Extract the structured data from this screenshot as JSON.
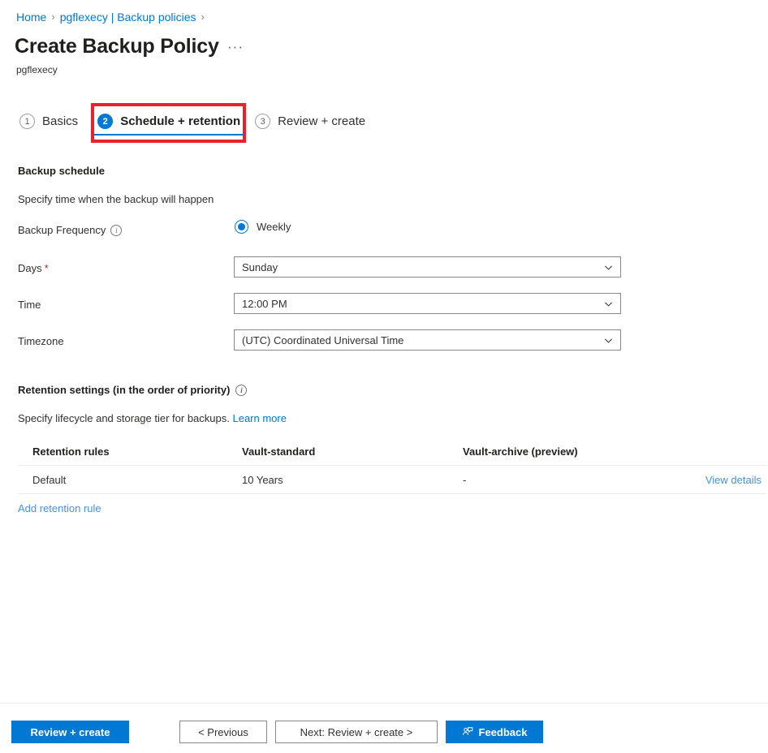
{
  "breadcrumb": {
    "items": [
      {
        "label": "Home",
        "icon": "none"
      },
      {
        "label": "pgflexecy | Backup policies",
        "icon": "none"
      }
    ],
    "separator": "›"
  },
  "header": {
    "title": "Create Backup Policy",
    "subtitle": "pgflexecy",
    "more_menu": "···",
    "more_menu_icon": "ellipsis-icon"
  },
  "wizard": {
    "steps": [
      {
        "number": "1",
        "label": "Basics",
        "state": "inactive"
      },
      {
        "number": "2",
        "label": "Schedule + retention",
        "state": "active"
      },
      {
        "number": "3",
        "label": "Review + create",
        "state": "inactive"
      }
    ],
    "highlight_color": "#e8212a",
    "active_color": "#0078d4"
  },
  "schedule": {
    "section_title": "Backup schedule",
    "section_description": "Specify time when the backup will happen",
    "frequency": {
      "label": "Backup Frequency",
      "info_icon": "info-icon",
      "selected": "Weekly",
      "options": [
        "Weekly"
      ]
    },
    "days": {
      "label": "Days",
      "required_marker": "*",
      "value": "Sunday"
    },
    "time": {
      "label": "Time",
      "value": "12:00 PM"
    },
    "timezone": {
      "label": "Timezone",
      "value": "(UTC) Coordinated Universal Time"
    }
  },
  "retention": {
    "section_title": "Retention settings (in the order of priority)",
    "info_icon": "info-icon",
    "description_text": "Specify lifecycle and storage tier for backups.",
    "learn_more": "Learn more",
    "table": {
      "columns": [
        "Retention rules",
        "Vault-standard",
        "Vault-archive (preview)",
        ""
      ],
      "rows": [
        {
          "rule": "Default",
          "vault_standard": "10 Years",
          "vault_archive": "-",
          "action": "View details"
        }
      ]
    },
    "add_rule_link": "Add retention rule"
  },
  "footer": {
    "review_create": "Review + create",
    "previous": "< Previous",
    "next": "Next: Review + create >",
    "feedback": "Feedback",
    "feedback_icon": "feedback-person-icon"
  }
}
